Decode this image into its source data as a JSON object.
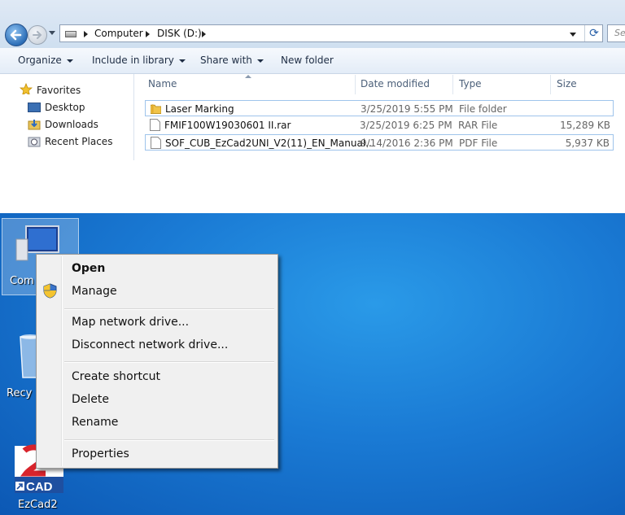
{
  "explorer": {
    "breadcrumb": [
      "Computer",
      "DISK (D:)"
    ],
    "search_placeholder": "Se",
    "toolbar": {
      "organize": "Organize",
      "include_in_library": "Include in library",
      "share_with": "Share with",
      "new_folder": "New folder"
    },
    "favorites": {
      "header": "Favorites",
      "items": [
        "Desktop",
        "Downloads",
        "Recent Places"
      ]
    },
    "columns": {
      "name": "Name",
      "date_modified": "Date modified",
      "type": "Type",
      "size": "Size"
    },
    "files": [
      {
        "name": "Laser Marking",
        "date": "3/25/2019 5:55 PM",
        "type": "File folder",
        "size": "",
        "icon": "folder-icon"
      },
      {
        "name": "FMIF100W19030601 II.rar",
        "date": "3/25/2019 6:25 PM",
        "type": "RAR File",
        "size": "15,289 KB",
        "icon": "file-icon"
      },
      {
        "name": "SOF_CUB_EzCad2UNI_V2(11)_EN_Manual...",
        "date": "9/14/2016 2:36 PM",
        "type": "PDF File",
        "size": "5,937 KB",
        "icon": "file-icon"
      }
    ]
  },
  "desktop": {
    "icons": [
      {
        "label": "Com",
        "icon": "computer-icon"
      },
      {
        "label": "Recy",
        "icon": "recycle-bin-icon"
      },
      {
        "label": "EzCad2",
        "icon": "ezcad-icon"
      }
    ],
    "ezcad_logo_text": "CAD",
    "context_menu": {
      "items": [
        {
          "label": "Open",
          "bold": true
        },
        {
          "label": "Manage",
          "icon": "shield-icon"
        },
        {
          "label": "Map network drive..."
        },
        {
          "label": "Disconnect network drive..."
        },
        {
          "label": "Create shortcut"
        },
        {
          "label": "Delete"
        },
        {
          "label": "Rename"
        },
        {
          "label": "Properties"
        }
      ]
    }
  }
}
